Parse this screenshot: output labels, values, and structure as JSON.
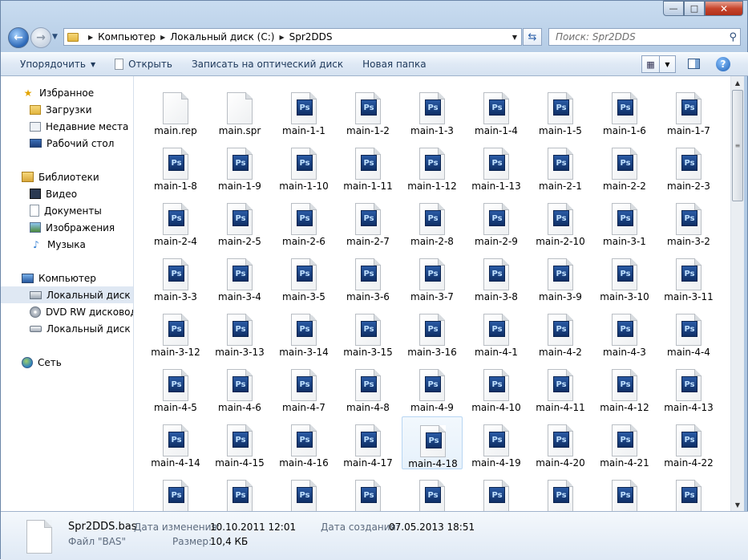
{
  "window": {
    "minimize": "—",
    "maximize": "□",
    "close": "✕"
  },
  "address": {
    "crumbs": [
      "Компьютер",
      "Локальный диск (C:)",
      "Spr2DDS"
    ],
    "search_placeholder": "Поиск: Spr2DDS"
  },
  "toolbar": {
    "organize": "Упорядочить",
    "open": "Открыть",
    "burn": "Записать на оптический диск",
    "new_folder": "Новая папка",
    "help": "?"
  },
  "sidebar": {
    "favorites": "Избранное",
    "downloads": "Загрузки",
    "recent": "Недавние места",
    "desktop": "Рабочий стол",
    "libraries": "Библиотеки",
    "video": "Видео",
    "documents": "Документы",
    "images": "Изображения",
    "music": "Музыка",
    "computer": "Компьютер",
    "local_disk": "Локальный диск (C",
    "dvd": "DVD RW дисковод (",
    "removable": "Локальный диск (K"
  },
  "network": "Сеть",
  "files": [
    {
      "name": "main.rep",
      "type": "blank"
    },
    {
      "name": "main.spr",
      "type": "blank"
    },
    {
      "name": "main-1-1",
      "type": "ps"
    },
    {
      "name": "main-1-2",
      "type": "ps"
    },
    {
      "name": "main-1-3",
      "type": "ps"
    },
    {
      "name": "main-1-4",
      "type": "ps"
    },
    {
      "name": "main-1-5",
      "type": "ps"
    },
    {
      "name": "main-1-6",
      "type": "ps"
    },
    {
      "name": "main-1-7",
      "type": "ps"
    },
    {
      "name": "main-1-8",
      "type": "ps"
    },
    {
      "name": "main-1-9",
      "type": "ps"
    },
    {
      "name": "main-1-10",
      "type": "ps"
    },
    {
      "name": "main-1-11",
      "type": "ps"
    },
    {
      "name": "main-1-12",
      "type": "ps"
    },
    {
      "name": "main-1-13",
      "type": "ps"
    },
    {
      "name": "main-2-1",
      "type": "ps"
    },
    {
      "name": "main-2-2",
      "type": "ps"
    },
    {
      "name": "main-2-3",
      "type": "ps"
    },
    {
      "name": "main-2-4",
      "type": "ps"
    },
    {
      "name": "main-2-5",
      "type": "ps"
    },
    {
      "name": "main-2-6",
      "type": "ps"
    },
    {
      "name": "main-2-7",
      "type": "ps"
    },
    {
      "name": "main-2-8",
      "type": "ps"
    },
    {
      "name": "main-2-9",
      "type": "ps"
    },
    {
      "name": "main-2-10",
      "type": "ps"
    },
    {
      "name": "main-3-1",
      "type": "ps"
    },
    {
      "name": "main-3-2",
      "type": "ps"
    },
    {
      "name": "main-3-3",
      "type": "ps"
    },
    {
      "name": "main-3-4",
      "type": "ps"
    },
    {
      "name": "main-3-5",
      "type": "ps"
    },
    {
      "name": "main-3-6",
      "type": "ps"
    },
    {
      "name": "main-3-7",
      "type": "ps"
    },
    {
      "name": "main-3-8",
      "type": "ps"
    },
    {
      "name": "main-3-9",
      "type": "ps"
    },
    {
      "name": "main-3-10",
      "type": "ps"
    },
    {
      "name": "main-3-11",
      "type": "ps"
    },
    {
      "name": "main-3-12",
      "type": "ps"
    },
    {
      "name": "main-3-13",
      "type": "ps"
    },
    {
      "name": "main-3-14",
      "type": "ps"
    },
    {
      "name": "main-3-15",
      "type": "ps"
    },
    {
      "name": "main-3-16",
      "type": "ps"
    },
    {
      "name": "main-4-1",
      "type": "ps"
    },
    {
      "name": "main-4-2",
      "type": "ps"
    },
    {
      "name": "main-4-3",
      "type": "ps"
    },
    {
      "name": "main-4-4",
      "type": "ps"
    },
    {
      "name": "main-4-5",
      "type": "ps"
    },
    {
      "name": "main-4-6",
      "type": "ps"
    },
    {
      "name": "main-4-7",
      "type": "ps"
    },
    {
      "name": "main-4-8",
      "type": "ps"
    },
    {
      "name": "main-4-9",
      "type": "ps"
    },
    {
      "name": "main-4-10",
      "type": "ps"
    },
    {
      "name": "main-4-11",
      "type": "ps"
    },
    {
      "name": "main-4-12",
      "type": "ps"
    },
    {
      "name": "main-4-13",
      "type": "ps"
    },
    {
      "name": "main-4-14",
      "type": "ps"
    },
    {
      "name": "main-4-15",
      "type": "ps"
    },
    {
      "name": "main-4-16",
      "type": "ps"
    },
    {
      "name": "main-4-17",
      "type": "ps"
    },
    {
      "name": "main-4-18",
      "type": "ps",
      "selected": true
    },
    {
      "name": "main-4-19",
      "type": "ps"
    },
    {
      "name": "main-4-20",
      "type": "ps"
    },
    {
      "name": "main-4-21",
      "type": "ps"
    },
    {
      "name": "main-4-22",
      "type": "ps"
    },
    {
      "name": "",
      "type": "ps"
    },
    {
      "name": "",
      "type": "ps"
    },
    {
      "name": "",
      "type": "ps"
    },
    {
      "name": "",
      "type": "ps"
    },
    {
      "name": "",
      "type": "ps"
    },
    {
      "name": "",
      "type": "ps"
    },
    {
      "name": "",
      "type": "ps"
    },
    {
      "name": "",
      "type": "ps"
    },
    {
      "name": "",
      "type": "ps"
    }
  ],
  "details": {
    "filename": "Spr2DDS.bas",
    "filetype": "Файл \"BAS\"",
    "modified_label": "Дата изменения:",
    "modified_value": "10.10.2011 12:01",
    "created_label": "Дата создания:",
    "created_value": "07.05.2013 18:51",
    "size_label": "Размер:",
    "size_value": "10,4 КБ"
  }
}
